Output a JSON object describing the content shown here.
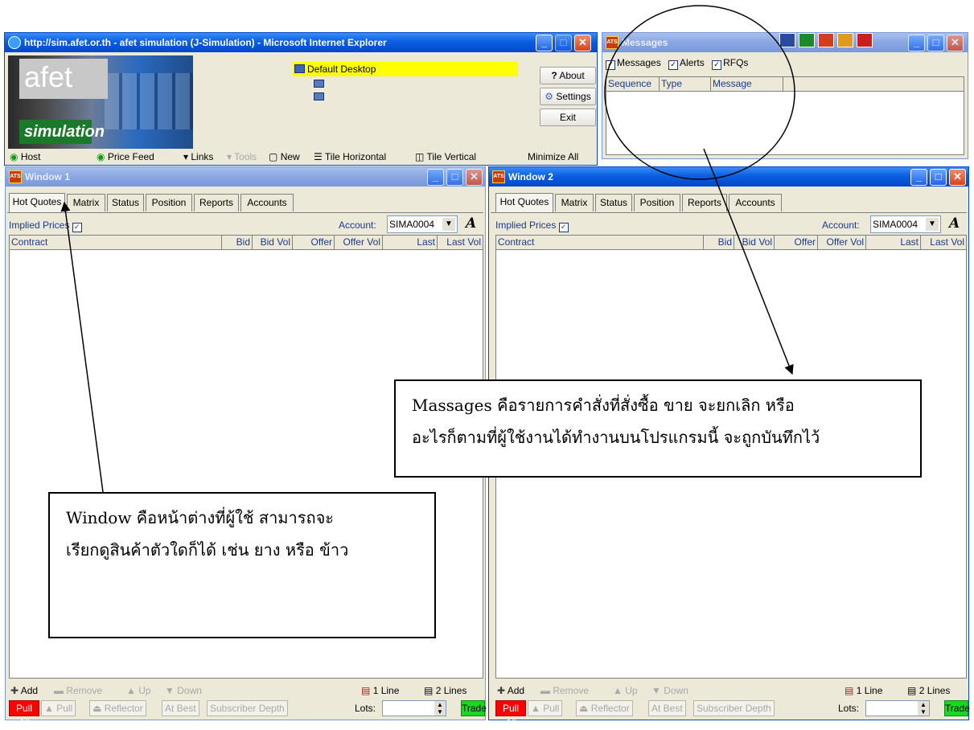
{
  "ie": {
    "title": "http://sim.afet.or.th - afet simulation (J-Simulation) - Microsoft Internet Explorer",
    "logo_top": "afet",
    "logo_bottom": "simulation",
    "desktop": "Default Desktop",
    "about": "About",
    "settings": "Settings",
    "exit": "Exit",
    "toolbar": {
      "host": "Host",
      "price_feed": "Price Feed",
      "links": "Links",
      "tools": "Tools",
      "new": "New",
      "tile_horizontal": "Tile Horizontal",
      "tile_vertical": "Tile Vertical",
      "minimize_all": "Minimize All"
    }
  },
  "messages": {
    "title": "Messages",
    "filters": {
      "messages": "Messages",
      "alerts": "Alerts",
      "rfqs": "RFQs"
    },
    "columns": {
      "sequence": "Sequence",
      "type": "Type",
      "message": "Message"
    }
  },
  "window1": {
    "title": "Window 1"
  },
  "window2": {
    "title": "Window 2"
  },
  "trade": {
    "tabs": [
      "Hot Quotes",
      "Matrix",
      "Status",
      "Position",
      "Reports",
      "Accounts"
    ],
    "implied_prices": "Implied Prices",
    "account_label": "Account:",
    "account_value": "SIMA0004",
    "columns": {
      "contract": "Contract",
      "bid": "Bid",
      "bid_vol": "Bid Vol",
      "offer": "Offer",
      "offer_vol": "Offer Vol",
      "last": "Last",
      "last_vol": "Last Vol"
    },
    "add": "Add",
    "remove": "Remove",
    "up": "Up",
    "down": "Down",
    "one_line": "1 Line",
    "two_lines": "2 Lines",
    "pull_all": "Pull All",
    "pull": "Pull",
    "reflector": "Reflector",
    "at_best": "At Best",
    "subscriber_depth": "Subscriber Depth",
    "lots": "Lots:",
    "trade": "Trade"
  },
  "annotations": {
    "window_line1": "Window คือหน้าต่างที่ผู้ใช้ สามารถจะ",
    "window_line2": "เรียกดูสินค้าตัวใดก็ได้ เช่น ยาง หรือ ข้าว",
    "messages_line1": "Massages คือรายการคำสั่งที่สั่งซื้อ ขาย จะยกเลิก หรือ",
    "messages_line2": "อะไรก็ตามที่ผู้ใช้งานได้ทำงานบนโปรแกรมนี้ จะถูกบันทึกไว้"
  },
  "colors": {
    "xp_title": "#0a5fe0",
    "desktop_highlight": "#ffff00",
    "pull_all": "#ff0000",
    "trade": "#19d81f",
    "window_bg": "#ece9d8"
  }
}
